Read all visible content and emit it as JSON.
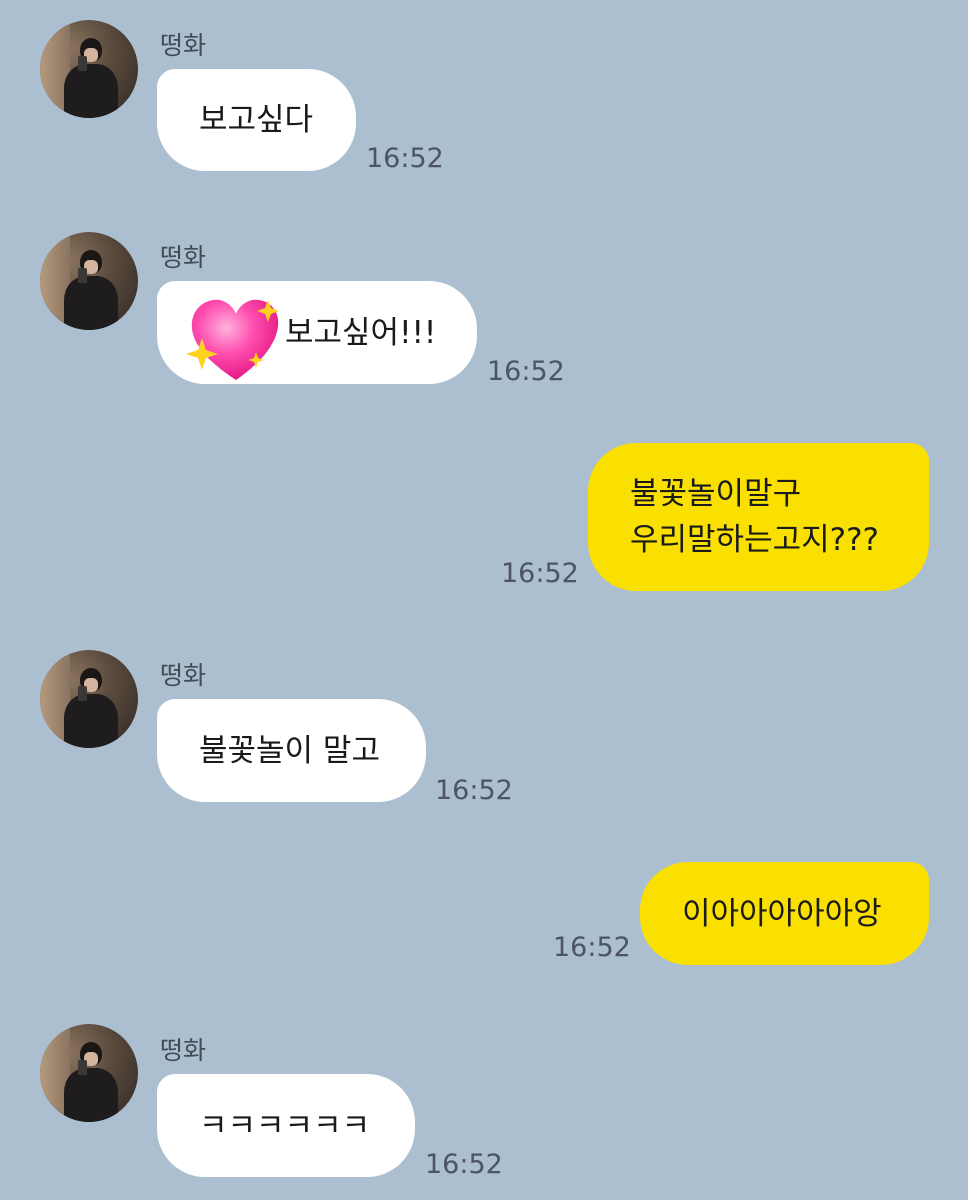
{
  "messages": [
    {
      "sender": "떵화",
      "text": "보고싶다",
      "time": "16:52"
    },
    {
      "sender": "떵화",
      "text": "보고싶어!!!",
      "emoji": "sparkling-heart",
      "time": "16:52"
    },
    {
      "sender": "me",
      "lines": [
        "불꽃놀이말구",
        "우리말하는고지???"
      ],
      "time": "16:52"
    },
    {
      "sender": "떵화",
      "text": "불꽃놀이 말고",
      "time": "16:52"
    },
    {
      "sender": "me",
      "text": "이아아아아아앙",
      "time": "16:52"
    },
    {
      "sender": "떵화",
      "text": "ㅋㅋㅋㅋㅋㅋ",
      "time": "16:52"
    }
  ],
  "colors": {
    "background": "#abbfd0",
    "incoming": "#ffffff",
    "outgoing": "#f9e000",
    "heart": "#ff3ea5"
  }
}
